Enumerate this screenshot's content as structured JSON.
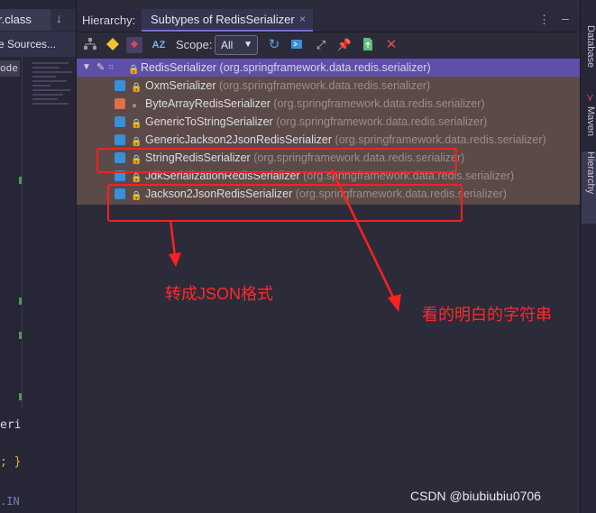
{
  "editor": {
    "file_tab": "r.class",
    "banner": "e Sources...",
    "code_tag": "ode",
    "code_fragments": [
      "eri",
      "; }",
      ".IN"
    ]
  },
  "hierarchy": {
    "panel_title": "Hierarchy:",
    "tab_label": "Subtypes of RedisSerializer",
    "tab_close": "×",
    "scope_label": "Scope:",
    "scope_value": "All",
    "root": {
      "name": "RedisSerializer",
      "package": "(org.springframework.data.redis.serializer)"
    },
    "items": [
      {
        "name": "OxmSerializer",
        "package": "(org.springframework.data.redis.serializer)"
      },
      {
        "name": "ByteArrayRedisSerializer",
        "package": "(org.springframework.data.redis.serializer)"
      },
      {
        "name": "GenericToStringSerializer",
        "package": "(org.springframework.data.redis.serializer)"
      },
      {
        "name": "GenericJackson2JsonRedisSerializer",
        "package": "(org.springframework.data.redis.serializer)"
      },
      {
        "name": "StringRedisSerializer",
        "package": "(org.springframework.data.redis.serializer)"
      },
      {
        "name": "JdkSerializationRedisSerializer",
        "package": "(org.springframework.data.redis.serializer)"
      },
      {
        "name": "Jackson2JsonRedisSerializer",
        "package": "(org.springframework.data.redis.serializer)"
      }
    ]
  },
  "annotations": {
    "note_json": "转成JSON格式",
    "note_readable": "看的明白的字符串",
    "color": "#ff2020"
  },
  "right_strip": {
    "tools": [
      "Database",
      "Maven",
      "Hierarchy"
    ]
  },
  "watermark": "CSDN @biubiubiu0706"
}
